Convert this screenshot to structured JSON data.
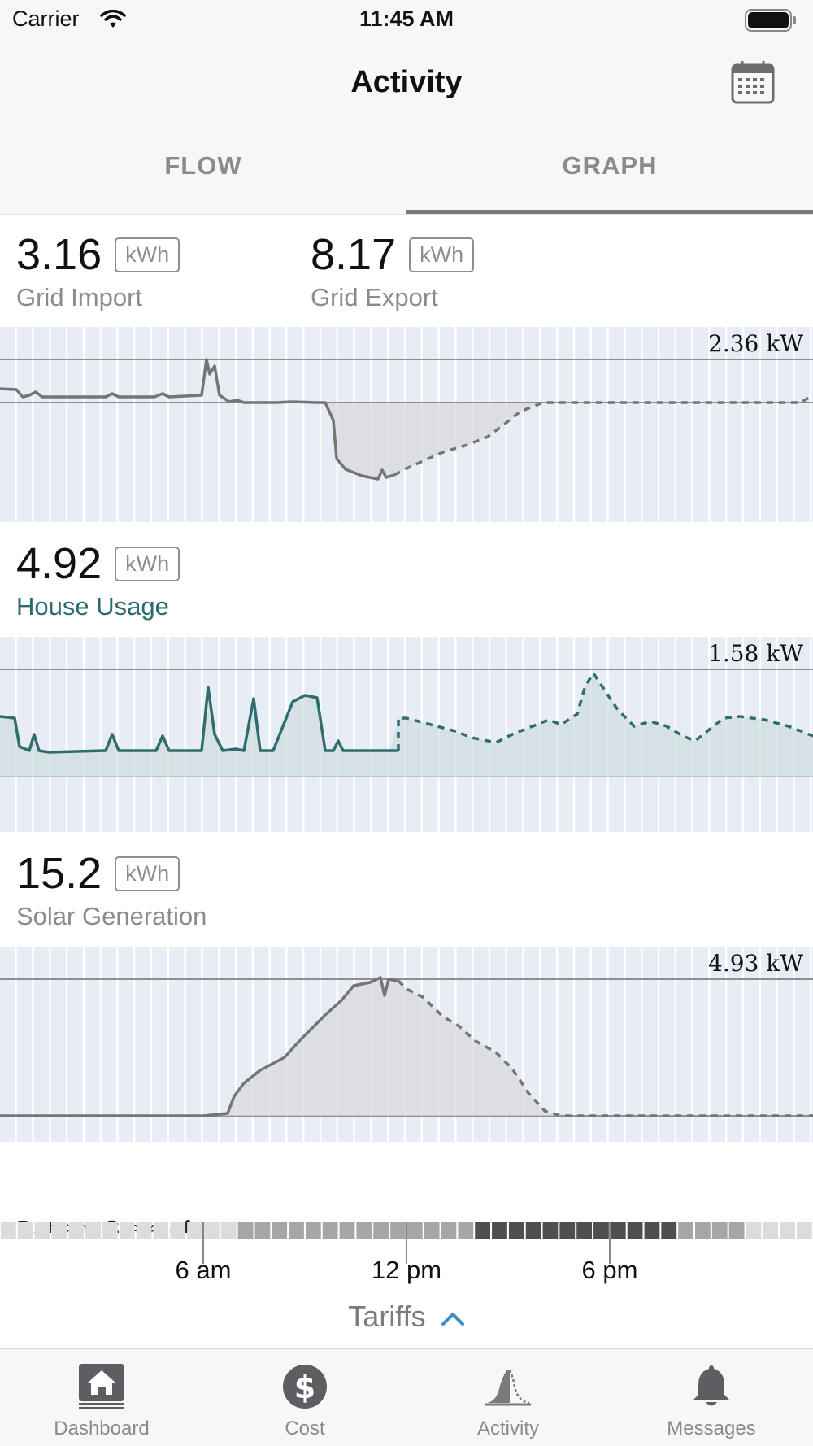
{
  "status_bar": {
    "carrier": "Carrier",
    "time": "11:45 AM"
  },
  "nav": {
    "title": "Activity",
    "calendar_icon": "calendar-icon"
  },
  "tabs": [
    {
      "label": "FLOW",
      "selected": false
    },
    {
      "label": "GRAPH",
      "selected": true
    }
  ],
  "grid": {
    "import_value": "3.16",
    "import_unit": "kWh",
    "import_label": "Grid Import",
    "export_value": "8.17",
    "export_unit": "kWh",
    "export_label": "Grid Export",
    "peak": "2.36 kW"
  },
  "house": {
    "value": "4.92",
    "unit": "kWh",
    "label": "House Usage",
    "peak": "1.58 kW"
  },
  "solar": {
    "value": "15.2",
    "unit": "kWh",
    "label": "Solar Generation",
    "peak": "4.93 kW"
  },
  "battery_soc_label": "Battery State of Charge",
  "time_axis": [
    "6 am",
    "12 pm",
    "6 pm"
  ],
  "tariffs_label": "Tariffs",
  "tabbar": [
    {
      "label": "Dashboard",
      "icon": "house-icon"
    },
    {
      "label": "Cost",
      "icon": "dollar-icon"
    },
    {
      "label": "Activity",
      "icon": "activity-icon"
    },
    {
      "label": "Messages",
      "icon": "bell-icon"
    }
  ],
  "colors": {
    "chart_bg": "#e8ecf5",
    "chart_stripe": "#ffffff",
    "teal": "#2a6b6b",
    "gray_line": "#757575",
    "tab_indicator": "#7a7a7a",
    "accent_blue": "#3a8ec8"
  }
}
